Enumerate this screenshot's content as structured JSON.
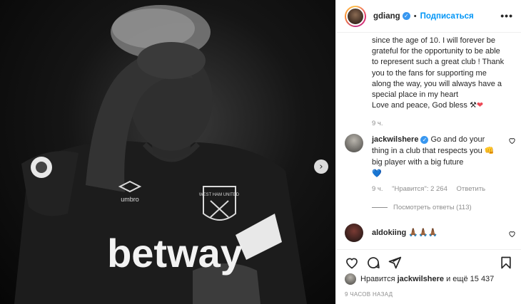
{
  "photo": {
    "sponsor_text": "betway",
    "kit_brand": "umbro",
    "crest_text": "WEST HAM UNITED",
    "next_glyph": "›"
  },
  "post": {
    "author": "gdiang",
    "follow_label": "Подписаться",
    "more_glyph": "•••",
    "caption_lines": [
      "since the age of 10. I will forever be",
      "grateful for the opportunity to be able",
      "to represent such a great club ! Thank",
      "you to the fans for supporting me",
      "along the way, you will always have a",
      "special place in my heart",
      "Love and peace, God bless ⚒"
    ],
    "caption_heart": "❤",
    "caption_time": "9 ч."
  },
  "comments": [
    {
      "user": "jackwilshere",
      "text": "Go and do your thing in a club that respects you",
      "emoji_fist": "👊",
      "text2": "big player with a big future",
      "emoji_heart": "💙",
      "time": "9 ч.",
      "likes": "\"Нравится\": 2 264",
      "reply": "Ответить",
      "view_replies": "Посмотреть ответы (113)"
    },
    {
      "user": "aldokiing",
      "text": "🙏🏾🙏🏾🙏🏾"
    }
  ],
  "footer": {
    "liked_prefix": "Нравится",
    "liked_user": "jackwilshere",
    "liked_suffix": "и ещё 15 437",
    "time": "9 ЧАСОВ НАЗАД"
  },
  "colors": {
    "accent": "#0095f6",
    "verified": "#3897f0",
    "heart": "#ed4956",
    "muted": "#8e8e8e"
  },
  "icons": [
    "heart-icon",
    "comment-icon",
    "share-icon",
    "bookmark-icon",
    "verified-icon",
    "more-icon",
    "chevron-right-icon"
  ]
}
